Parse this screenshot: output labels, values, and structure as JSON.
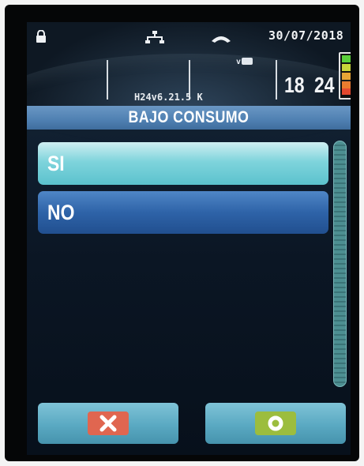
{
  "status": {
    "date": "30/07/2018",
    "time_hour": "18",
    "time_minute": "24",
    "wifi_label": "v"
  },
  "version": "H24v6.21.5 K",
  "title": "BAJO CONSUMO",
  "options": [
    {
      "label": "SI",
      "selected": true
    },
    {
      "label": "NO",
      "selected": false
    }
  ],
  "battery": {
    "level": 0.6,
    "colors": [
      "#5ccf3b",
      "#c9d53a",
      "#f0a52a",
      "#e5492f"
    ]
  },
  "icons": {
    "lock": "lock-icon",
    "network": "network-icon",
    "handset": "handset-icon",
    "cancel": "close-icon",
    "confirm": "ok-circle-icon"
  },
  "colors": {
    "title_bar": "#4f80b2",
    "selected_option": "#7fd4dc",
    "unselected_option": "#2e63a8",
    "cancel_icon": "#e06650",
    "confirm_icon": "#9cbd3e"
  }
}
